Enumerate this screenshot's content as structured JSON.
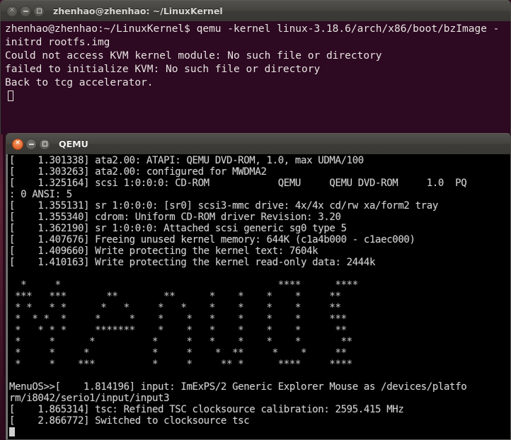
{
  "desktop": {
    "background_color": "#2b0a1c"
  },
  "terminal_window": {
    "title": "zhenhao@zhenhao: ~/LinuxKernel",
    "active": false,
    "background_color": "#2d0922",
    "foreground_color": "#e8e4e0",
    "buttons": {
      "close": "×",
      "minimize": "minimize-glyph",
      "maximize": "maximize-glyph"
    },
    "lines": [
      "zhenhao@zhenhao:~/LinuxKernel$ qemu -kernel linux-3.18.6/arch/x86/boot/bzImage -",
      "initrd rootfs.img",
      "Could not access KVM kernel module: No such file or directory",
      "failed to initialize KVM: No such file or directory",
      "Back to tcg accelerator."
    ],
    "cursor_visible": true
  },
  "qemu_window": {
    "title": "QEMU",
    "active": true,
    "background_color": "#000000",
    "foreground_color": "#cfcfcf",
    "accent_color": "#e8733a",
    "buttons": {
      "close": "×",
      "minimize": "minimize-glyph",
      "maximize": "maximize-glyph"
    },
    "kernel_log_top": [
      "[    1.301338] ata2.00: ATAPI: QEMU DVD-ROM, 1.0, max UDMA/100",
      "[    1.303263] ata2.00: configured for MWDMA2",
      "[    1.325164] scsi 1:0:0:0: CD-ROM            QEMU     QEMU DVD-ROM     1.0  PQ",
      ": 0 ANSI: 5",
      "[    1.355131] sr 1:0:0:0: [sr0] scsi3-mmc drive: 4x/4x cd/rw xa/form2 tray",
      "[    1.355340] cdrom: Uniform CD-ROM driver Revision: 3.20",
      "[    1.362190] sr 1:0:0:0: Attached scsi generic sg0 type 5",
      "[    1.407676] Freeing unused kernel memory: 644K (c1a4b000 - c1aec000)",
      "[    1.409660] Write protecting the kernel text: 7604k",
      "[    1.410163] Write protecting the kernel read-only data: 2444k"
    ],
    "ascii_art_banner": [
      "  *     *                                      ****      ****",
      " ***   ***       **        **      *    *    *    *     **",
      " * *   * *      *   *     *   *    *    *    *    *     **",
      " *  * *  *     *     *    *    *   *    *    *    *     ***",
      " *   * * *     *******    *    *   *    *    *    *      **",
      " *     *      *          *     *   *    *    *    *       **",
      " *     *     *           *     *    *  **     *    *     **",
      " *     *    ***          *     *     ** *      ****     ****"
    ],
    "kernel_log_bottom": [
      "MenuOS>>[    1.814196] input: ImExPS/2 Generic Explorer Mouse as /devices/platfo",
      "rm/i8042/serio1/input/input3",
      "[    1.865314] tsc: Refined TSC clocksource calibration: 2595.415 MHz",
      "[    2.866772] Switched to clocksource tsc"
    ],
    "cursor_visible": true
  }
}
